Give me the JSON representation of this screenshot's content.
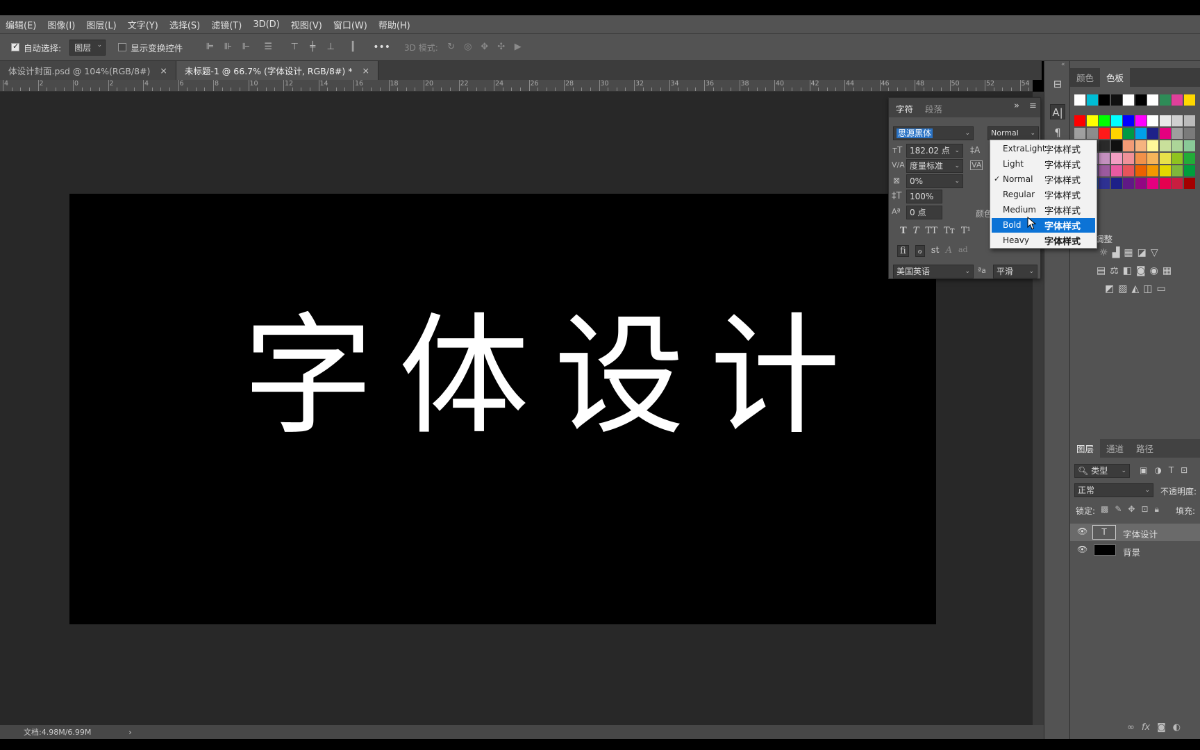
{
  "menu": [
    "编辑(E)",
    "图像(I)",
    "图层(L)",
    "文字(Y)",
    "选择(S)",
    "滤镜(T)",
    "3D(D)",
    "视图(V)",
    "窗口(W)",
    "帮助(H)"
  ],
  "options": {
    "auto_select_label": "自动选择:",
    "auto_select_value": "图层",
    "show_transform_label": "显示变换控件",
    "more": "•••",
    "mode3d": "3D 模式:"
  },
  "tabs": [
    {
      "label": "体设计封面.psd @ 104%(RGB/8#)",
      "close": "×"
    },
    {
      "label": "未标题-1 @ 66.7% (字体设计, RGB/8#) *",
      "close": "×"
    }
  ],
  "ruler_ticks": [
    "4",
    "2",
    "0",
    "2",
    "4",
    "6",
    "8",
    "10",
    "12",
    "14",
    "16",
    "18",
    "20",
    "22",
    "24",
    "26",
    "28",
    "30",
    "32",
    "34",
    "36",
    "38",
    "40",
    "42",
    "44",
    "46",
    "48",
    "50",
    "52",
    "54"
  ],
  "canvas": {
    "text": "字体设计",
    "bg": "#000000",
    "fg": "#ffffff"
  },
  "status": {
    "doc": "文档:4.98M/6.99M",
    "arrow": "›"
  },
  "char_panel": {
    "tabs": [
      "字符",
      "段落"
    ],
    "collapse": "»",
    "menu": "≡",
    "font_family": "思源黑体",
    "font_style": "Normal",
    "size": "182.02 点",
    "kerning": "度量标准",
    "tracking": "0%",
    "vscale": "100%",
    "baseline": "0 点",
    "color_label": "颜色",
    "style_buttons": [
      "T",
      "T",
      "TT",
      "Tт",
      "T¹"
    ],
    "opentype_buttons": [
      "fi",
      "ℴ",
      "st",
      "A",
      "ad"
    ],
    "language": "美国英语",
    "aa_label": "ªa",
    "antialias": "平滑"
  },
  "font_style_dropdown": {
    "checked": "Normal",
    "highlighted": "Bold",
    "items": [
      {
        "name": "ExtraLight",
        "preview": "字体样式"
      },
      {
        "name": "Light",
        "preview": "字体样式"
      },
      {
        "name": "Normal",
        "preview": "字体样式"
      },
      {
        "name": "Regular",
        "preview": "字体样式"
      },
      {
        "name": "Medium",
        "preview": "字体样式"
      },
      {
        "name": "Bold",
        "preview": "字体样式"
      },
      {
        "name": "Heavy",
        "preview": "字体样式"
      }
    ],
    "check_mark": "✓"
  },
  "right_dock": {
    "color_tabs": [
      "颜色",
      "色板"
    ],
    "adjust_label": "调整",
    "layers_tabs": [
      "图层",
      "通道",
      "路径"
    ],
    "filter_kind": "类型",
    "blend_mode": "正常",
    "opacity_label": "不透明度:",
    "lock_label": "锁定:",
    "fill_label": "填充:",
    "layers": [
      {
        "name": "字体设计",
        "type": "text"
      },
      {
        "name": "背景",
        "type": "fill"
      }
    ],
    "swatch_colors": [
      [
        "#ffffff",
        "#00bcd4",
        "#000000",
        "#101010",
        "#ffffff",
        "#000000",
        "#ffffff",
        "#2e8b57",
        "#e0409a",
        "#ffd800"
      ],
      [
        "#ff0000",
        "#ffff00",
        "#00ff00",
        "#00ffff",
        "#0000ff",
        "#ff00ff",
        "#ffffff",
        "#e8e8e8",
        "#d0d0d0",
        "#bbbbbb"
      ],
      [
        "#a0a0a0",
        "#8c8c8c",
        "#ff1a1a",
        "#ffd400",
        "#009944",
        "#00a0e9",
        "#1d2088",
        "#e4007f",
        "#9e9e9e",
        "#7a7a7a"
      ],
      [
        "#505050",
        "#3a3a3a",
        "#2a2a2a",
        "#101010",
        "#f29b76",
        "#f6b37f",
        "#fff799",
        "#c9e09b",
        "#acd598",
        "#89c997"
      ],
      [
        "#8f82bc",
        "#a78cbf",
        "#c490bf",
        "#f19ec2",
        "#f09199",
        "#f19149",
        "#f5b55a",
        "#e8e14a",
        "#8fc31f",
        "#22ac38"
      ],
      [
        "#6a73b5",
        "#7469a6",
        "#9b5a9e",
        "#e85aa1",
        "#e8545b",
        "#eb6100",
        "#f39800",
        "#e3d700",
        "#7fb83b",
        "#009e3c"
      ],
      [
        "#0078c8",
        "#1e50a2",
        "#2e3192",
        "#1d2088",
        "#601986",
        "#920783",
        "#e4007f",
        "#e5004f",
        "#c81d40",
        "#a40000"
      ]
    ]
  }
}
